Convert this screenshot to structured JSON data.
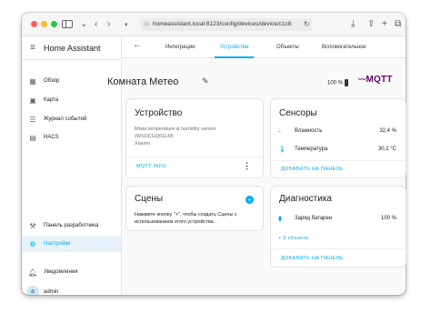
{
  "browser": {
    "url": "homeassistant.local:8123/config/devices/device/c1c8"
  },
  "sidebar": {
    "title": "Home Assistant",
    "items": [
      {
        "label": "Обзор"
      },
      {
        "label": "Карта"
      },
      {
        "label": "Журнал событий"
      },
      {
        "label": "HACS"
      }
    ],
    "bottom_items": [
      {
        "label": "Панель разработчика"
      },
      {
        "label": "Настройки"
      }
    ],
    "notifications_label": "Уведомления",
    "user_initial": "a",
    "user_name": "admin"
  },
  "tabs": [
    {
      "label": "Интеграции"
    },
    {
      "label": "Устройства"
    },
    {
      "label": "Объекты"
    },
    {
      "label": "Вспомогательное"
    }
  ],
  "device": {
    "title": "Комната Метео",
    "battery": "100 %",
    "integration_logo": "MQTT"
  },
  "device_card": {
    "title": "Устройство",
    "model_line1": "Miaia temperature & humidity sensor",
    "model_line2": "(WSDCGQ01LM)",
    "manufacturer": "Xiaomi",
    "action": "MQTT INFO"
  },
  "scenes_card": {
    "title": "Сцены",
    "text_line1": "Нажмите кнопку \"+\", чтобы создать Сцены с",
    "text_line2": "использованием этого устройства."
  },
  "sensors_card": {
    "title": "Сенсоры",
    "rows": [
      {
        "label": "Влажность",
        "value": "32,4 %"
      },
      {
        "label": "Температура",
        "value": "30,1 °C"
      }
    ],
    "action": "ДОБАВИТЬ НА ПАНЕЛЬ"
  },
  "diagnostics_card": {
    "title": "Диагностика",
    "rows": [
      {
        "label": "Заряд батареи",
        "value": "100 %"
      }
    ],
    "more": "+ 3 объекта",
    "action": "ДОБАВИТЬ НА ПАНЕЛЬ"
  },
  "colors": {
    "accent": "#03a9f4",
    "mqtt": "#660066"
  }
}
